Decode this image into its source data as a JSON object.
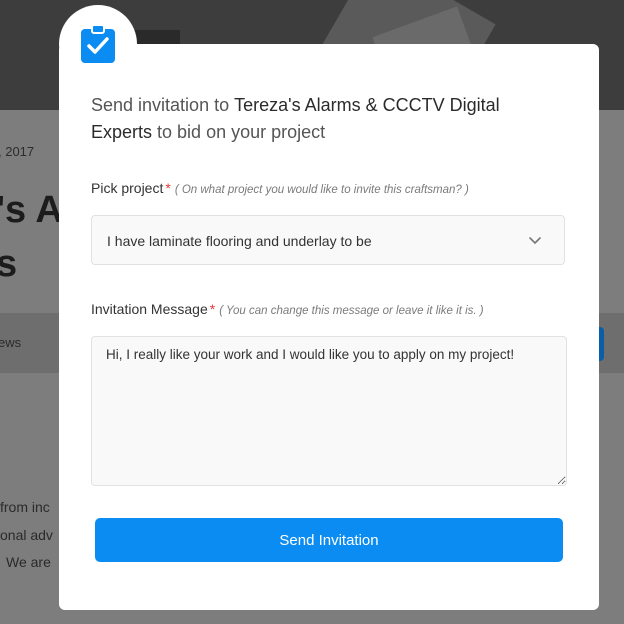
{
  "background": {
    "date": ", 2017",
    "title_line1": "'s A",
    "title_line2": "s",
    "reviews": "ews",
    "text1": "from inc",
    "text2": "onal adv",
    "text3": "We are"
  },
  "modal": {
    "headline_prefix": "Send invitation to ",
    "craftsman_name": "Tereza's Alarms & CCCTV Digital Experts",
    "headline_suffix": " to bid on your project",
    "project_label": "Pick project",
    "project_required": "*",
    "project_hint": "( On what project you would like to invite this craftsman? )",
    "project_selected": "I have laminate flooring and underlay to be",
    "message_label": "Invitation Message",
    "message_required": "*",
    "message_hint": "( You can change this message or leave it like it is. )",
    "message_value": "Hi, I really like your work and I would like you to apply on my project!",
    "send_button": "Send Invitation"
  },
  "icons": {
    "modal_icon": "clipboard-check-icon",
    "select_chevron": "chevron-down-icon"
  },
  "colors": {
    "accent": "#0a8cf2",
    "required": "#e53935"
  }
}
